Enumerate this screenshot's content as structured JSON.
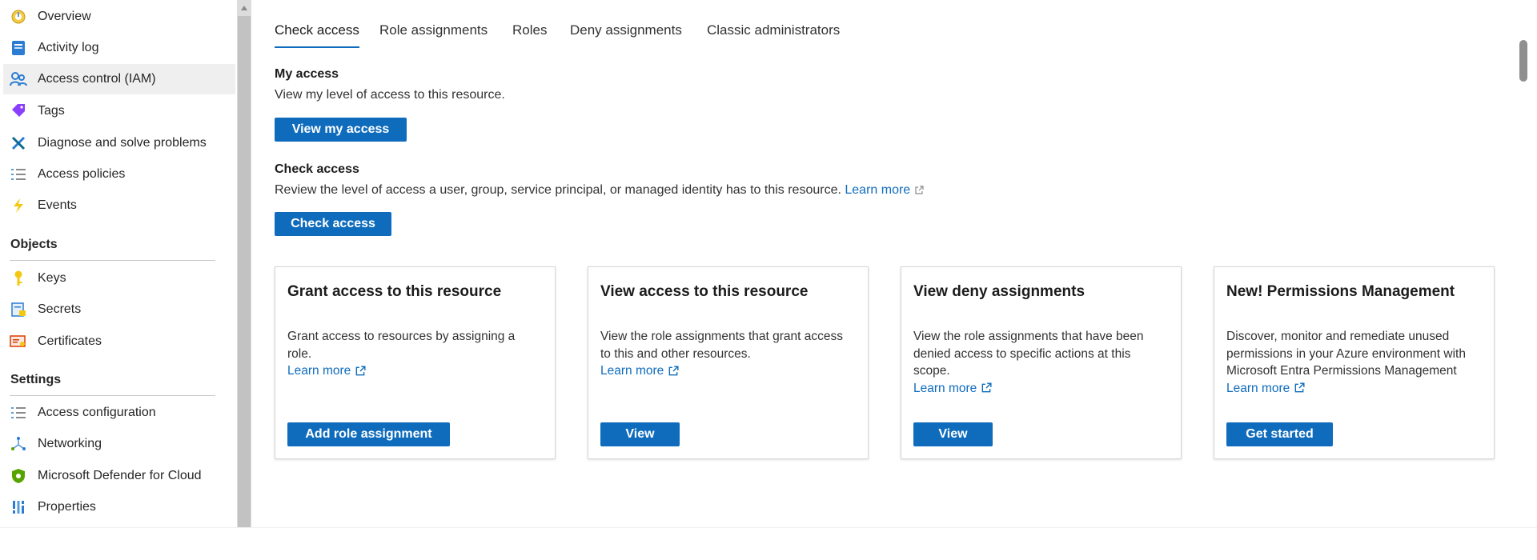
{
  "sidebar": {
    "items": [
      {
        "label": "Overview",
        "icon": "overview-icon"
      },
      {
        "label": "Activity log",
        "icon": "activity-log-icon"
      },
      {
        "label": "Access control (IAM)",
        "icon": "iam-icon",
        "active": true
      },
      {
        "label": "Tags",
        "icon": "tag-icon"
      },
      {
        "label": "Diagnose and solve problems",
        "icon": "wrench-icon"
      },
      {
        "label": "Access policies",
        "icon": "list-icon"
      },
      {
        "label": "Events",
        "icon": "lightning-icon"
      }
    ],
    "objects_heading": "Objects",
    "objects_items": [
      {
        "label": "Keys",
        "icon": "key-icon"
      },
      {
        "label": "Secrets",
        "icon": "secret-icon"
      },
      {
        "label": "Certificates",
        "icon": "certificate-icon"
      }
    ],
    "settings_heading": "Settings",
    "settings_items": [
      {
        "label": "Access configuration",
        "icon": "list-icon"
      },
      {
        "label": "Networking",
        "icon": "network-icon"
      },
      {
        "label": "Microsoft Defender for Cloud",
        "icon": "shield-icon"
      },
      {
        "label": "Properties",
        "icon": "properties-icon"
      }
    ]
  },
  "tabs": [
    "Check access",
    "Role assignments",
    "Roles",
    "Deny assignments",
    "Classic administrators"
  ],
  "my_access": {
    "heading": "My access",
    "description": "View my level of access to this resource.",
    "button": "View my access"
  },
  "check_access": {
    "heading": "Check access",
    "description": "Review the level of access a user, group, service principal, or managed identity has to this resource.",
    "learn_more": "Learn more",
    "button": "Check access"
  },
  "cards": [
    {
      "title": "Grant access to this resource",
      "description": "Grant access to resources by assigning a role.",
      "learn_more": "Learn more",
      "button": "Add role assignment"
    },
    {
      "title": "View access to this resource",
      "description": "View the role assignments that grant access to this and other resources.",
      "learn_more": "Learn more",
      "button": "View"
    },
    {
      "title": "View deny assignments",
      "description": "View the role assignments that have been denied access to specific actions at this scope.",
      "learn_more": "Learn more",
      "button": "View"
    },
    {
      "title": "New! Permissions Management",
      "description": "Discover, monitor and remediate unused permissions in your Azure environment with Microsoft Entra Permissions Management",
      "learn_more": "Learn more",
      "button": "Get started"
    }
  ],
  "colors": {
    "accent": "#0f6cbd",
    "active_nav_bg": "#efefef"
  }
}
